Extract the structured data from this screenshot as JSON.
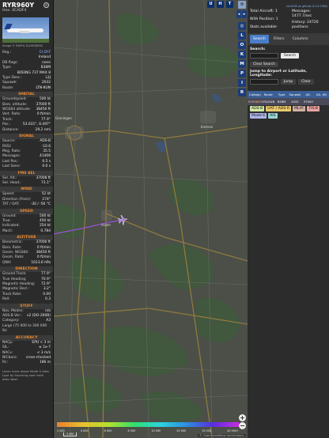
{
  "aircraft": {
    "callsign": "RYR960Y",
    "hex_label": "Hex:",
    "hex": "4CADF4",
    "photo_credit": "Image © RAPHL ELRED8060",
    "reg_label": "Reg.:",
    "reg": "EI-DYF",
    "country": "Ireland",
    "db_flags_label": "DB flags:",
    "db_flags": "none",
    "type_label": "Type:",
    "type": "B38M",
    "type_name": "BOEING 737 MAX 8",
    "type_desc_label": "Type Desc.:",
    "type_desc": "L2J",
    "squawk_label": "Squawk:",
    "squawk": "2032",
    "route_label": "Route:",
    "route": "LTN-KUN"
  },
  "spatial": {
    "title": "SPATIAL",
    "rows": [
      {
        "k": "Groundspeed:",
        "v": "500 kt"
      },
      {
        "k": "Baro. altitude:",
        "v": "37000 ft"
      },
      {
        "k": "WGS84 altitude:",
        "v": "38450 ft"
      },
      {
        "k": "Vert. Rate:",
        "v": "0 ft/min"
      },
      {
        "k": "Track:",
        "v": "77.9°"
      },
      {
        "k": "Pos.:",
        "v": "53.031°, 6.497°"
      },
      {
        "k": "Distance:",
        "v": "29.2 nmi"
      }
    ]
  },
  "signal": {
    "title": "SIGNAL",
    "rows": [
      {
        "k": "Source:",
        "v": "ADS-B"
      },
      {
        "k": "RSSI:",
        "v": "-10.6"
      },
      {
        "k": "Msg. Rate:",
        "v": "35.5"
      },
      {
        "k": "Messages:",
        "v": "41406"
      },
      {
        "k": "Last Pos.:",
        "v": "0.5 s"
      },
      {
        "k": "Last Seen:",
        "v": "0.0 s"
      }
    ]
  },
  "fms": {
    "title": "FMS SEL",
    "rows": [
      {
        "k": "Sel. Alt.:",
        "v": "37008 ft"
      },
      {
        "k": "Sel. Head.:",
        "v": "73.1°"
      }
    ]
  },
  "wind": {
    "title": "WIND",
    "rows": [
      {
        "k": "Speed:",
        "v": "52 kt"
      },
      {
        "k": "Direction (from):",
        "v": "274°"
      },
      {
        "k": "TAT / OAT:",
        "v": "-30 / -56 °C"
      }
    ]
  },
  "speed": {
    "title": "SPEED",
    "rows": [
      {
        "k": "Ground:",
        "v": "500 kt"
      },
      {
        "k": "True:",
        "v": "450 kt"
      },
      {
        "k": "Indicated:",
        "v": "254 kt"
      },
      {
        "k": "Mach:",
        "v": "0.784"
      }
    ]
  },
  "altitude": {
    "title": "ALTITUDE",
    "rows": [
      {
        "k": "Barometric:",
        "v": "37000 ft"
      },
      {
        "k": "Baro. Rate:",
        "v": "0 ft/min"
      },
      {
        "k": "Geom. WGS84:",
        "v": "38450 ft"
      },
      {
        "k": "Geom. Rate:",
        "v": "0 ft/min"
      },
      {
        "k": "QNH:",
        "v": "1013.6 hPa"
      }
    ]
  },
  "direction": {
    "title": "DIRECTION",
    "rows": [
      {
        "k": "Ground Track:",
        "v": "77.9°"
      },
      {
        "k": "True Heading:",
        "v": "70.9°"
      },
      {
        "k": "Magnetic Heading:",
        "v": "72.9°"
      },
      {
        "k": "Magnetic Decl.:",
        "v": "3.2°"
      },
      {
        "k": "Track Rate:",
        "v": "0.00"
      },
      {
        "k": "Roll:",
        "v": "0.3"
      }
    ]
  },
  "stuff": {
    "title": "STUFF",
    "rows": [
      {
        "k": "Nav. Modes:",
        "v": "n/a"
      },
      {
        "k": "ADS-B Ver.:",
        "v": "v2 (DO-260B)"
      },
      {
        "k": "Category:",
        "v": "A3"
      }
    ],
    "category_desc": "Large (75 000 to 300 000 lb)"
  },
  "accuracy": {
    "title": "ACCURACY",
    "rows": [
      {
        "k": "NACp:",
        "v": "EPU < 3 m"
      },
      {
        "k": "SIL:",
        "v": "≤ 1e-7"
      },
      {
        "k": "NACv:",
        "v": "< 3 m/s"
      },
      {
        "k": "NICbaro:",
        "v": "cross-checked"
      },
      {
        "k": "Rc:",
        "v": "186 m"
      }
    ],
    "footer": "Learn more about Mode S data type by hovering over each data label."
  },
  "map": {
    "top_buttons": [
      "U",
      "H",
      "T"
    ],
    "side_buttons": [
      "L",
      "O",
      "K",
      "M",
      "P",
      "I",
      "R"
    ],
    "cities": [
      "Groningen",
      "Emmen",
      "Assen"
    ],
    "legend_ticks": [
      "2 000",
      "4 000",
      "6 000",
      "8 000",
      "10 000",
      "20 000",
      "30 000",
      "40 000+"
    ],
    "scale": "5 NM",
    "attribution": "© OpenStreetMap contributors."
  },
  "panel": {
    "link": "tar1090 on github (3.14.1784)",
    "total_label": "Total Aircraft: 1",
    "position_label": "With Position: 1",
    "stats_label": "Stats available",
    "messages_label": "Messages: 1477.7/sec",
    "history_label": "History: 24726 positions",
    "tabs": [
      "Search",
      "Filters",
      "Columns"
    ],
    "search_label": "Search:",
    "search_button": "Search",
    "clear_search": "Clear Search",
    "jump_label": "Jump to Airport or Latitude, Longitude:",
    "jump_button": "Jump",
    "clear_button": "Clear",
    "columns": [
      "Callsign",
      "Route",
      "Type",
      "Squawk",
      "Alt.",
      "Alt. (ft)"
    ],
    "row": [
      "RYR960Y",
      "LTN-KUN",
      "B38M",
      "2032",
      "37000",
      ""
    ],
    "pills": [
      {
        "label": "ADS-B",
        "color": "#d0e8a0"
      },
      {
        "label": "UAT / ADS-R",
        "color": "#e9c96a"
      },
      {
        "label": "MLAT",
        "color": "#d3b0a3"
      },
      {
        "label": "TIS-B",
        "color": "#e8a3a3"
      },
      {
        "label": "Mode-S",
        "color": "#aeb4e8"
      },
      {
        "label": "AIS",
        "color": "#9ad6d6"
      }
    ]
  }
}
